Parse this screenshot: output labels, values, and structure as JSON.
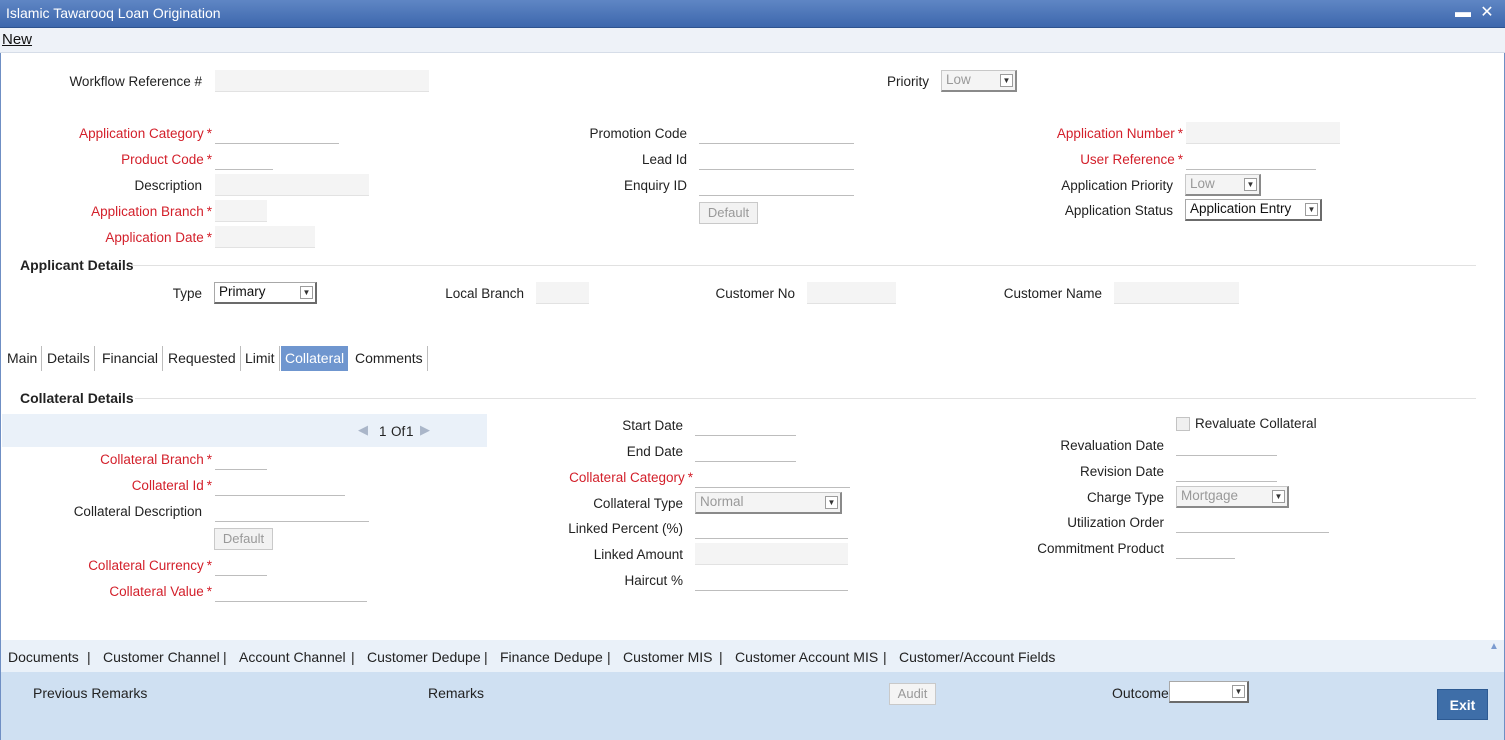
{
  "window": {
    "title": "Islamic Tawarooq Loan Origination",
    "minimize_icon": "minimize-icon",
    "close_icon": "close-icon",
    "minimize_glyph": "▬",
    "close_glyph": "✕"
  },
  "menu": {
    "new_label": "New"
  },
  "header": {
    "workflow_ref_label": "Workflow Reference #",
    "workflow_ref_value": "",
    "priority_label": "Priority",
    "priority_value": "Low"
  },
  "col1": {
    "application_category": {
      "label": "Application Category",
      "value": ""
    },
    "product_code": {
      "label": "Product Code",
      "value": ""
    },
    "description": {
      "label": "Description",
      "value": ""
    },
    "application_branch": {
      "label": "Application Branch",
      "value": ""
    },
    "application_date": {
      "label": "Application Date",
      "value": ""
    }
  },
  "col2": {
    "promotion_code": {
      "label": "Promotion Code",
      "value": ""
    },
    "lead_id": {
      "label": "Lead Id",
      "value": ""
    },
    "enquiry_id": {
      "label": "Enquiry ID",
      "value": ""
    },
    "default_label": "Default"
  },
  "col3": {
    "application_number": {
      "label": "Application Number",
      "value": ""
    },
    "user_reference": {
      "label": "User Reference",
      "value": ""
    },
    "application_priority": {
      "label": "Application Priority",
      "value": "Low"
    },
    "application_status": {
      "label": "Application Status",
      "value": "Application Entry"
    }
  },
  "applicant": {
    "section_title": "Applicant Details",
    "type_label": "Type",
    "type_value": "Primary",
    "local_branch_label": "Local Branch",
    "customer_no_label": "Customer No",
    "customer_name_label": "Customer Name"
  },
  "tabs": [
    "Main",
    "Details",
    "Financial",
    "Requested",
    "Limit",
    "Collateral",
    "Comments"
  ],
  "collateral": {
    "section_title": "Collateral Details",
    "pager": {
      "current": "1",
      "of_label": "Of",
      "total": "1"
    },
    "branch_label": "Collateral Branch",
    "id_label": "Collateral Id",
    "description_label": "Collateral Description",
    "default_label": "Default",
    "currency_label": "Collateral Currency",
    "value_label": "Collateral Value",
    "start_date_label": "Start Date",
    "end_date_label": "End Date",
    "category_label": "Collateral Category",
    "type_label": "Collateral Type",
    "type_value": "Normal",
    "linked_percent_label": "Linked Percent (%)",
    "linked_amount_label": "Linked Amount",
    "haircut_label": "Haircut %",
    "revaluate_label": "Revaluate Collateral",
    "revaluation_date_label": "Revaluation Date",
    "revision_date_label": "Revision Date",
    "charge_type_label": "Charge Type",
    "charge_type_value": "Mortgage",
    "utilization_order_label": "Utilization Order",
    "commitment_product_label": "Commitment Product"
  },
  "links": [
    "Documents",
    "Customer Channel",
    "Account Channel",
    "Customer Dedupe",
    "Finance Dedupe",
    "Customer MIS",
    "Customer Account MIS",
    "Customer/Account Fields"
  ],
  "footer": {
    "previous_remarks_label": "Previous Remarks",
    "remarks_label": "Remarks",
    "audit_label": "Audit",
    "outcome_label": "Outcome",
    "outcome_value": "",
    "exit_label": "Exit"
  }
}
